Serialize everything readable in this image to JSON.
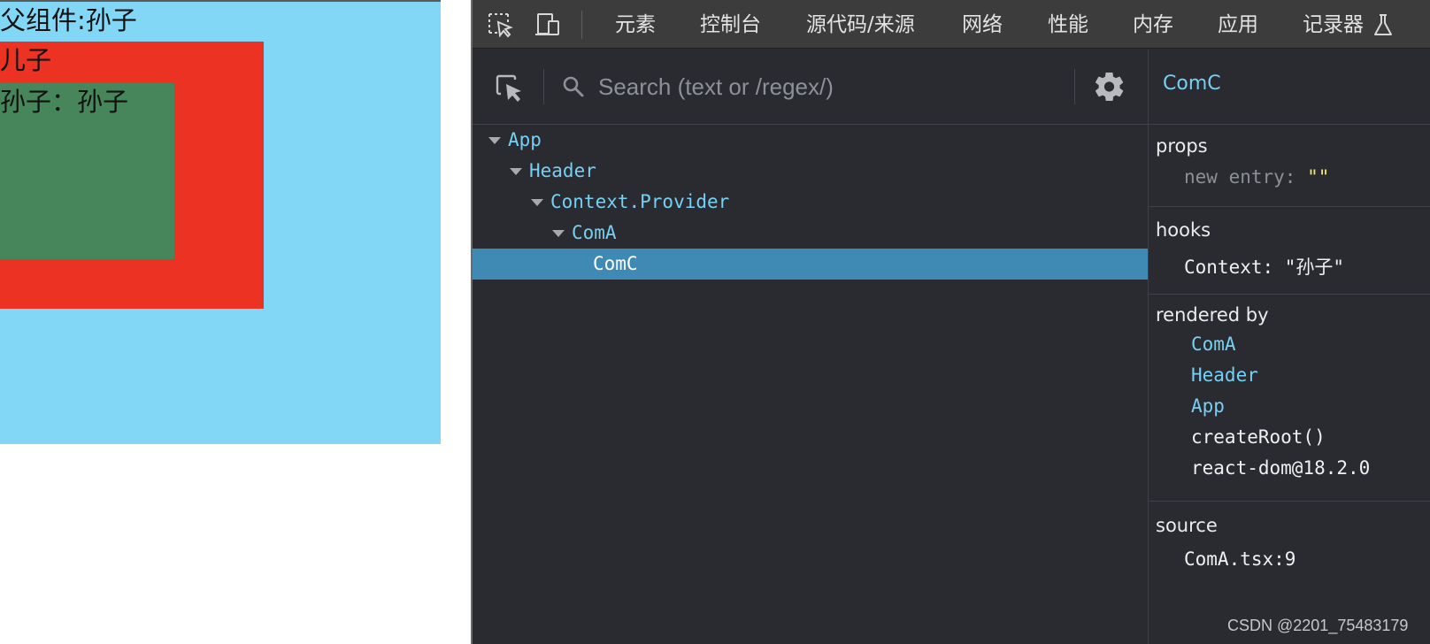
{
  "page": {
    "parent_label": "父组件:孙子",
    "son_label": "儿子",
    "grandson_label": "孙子：孙子",
    "colors": {
      "parent_bg": "#82d7f6",
      "son_bg": "#ec3323",
      "grandson_bg": "#47855a"
    }
  },
  "devtools": {
    "toolbar": {
      "icons": [
        "element-picker-icon",
        "device-toggle-icon"
      ],
      "tabs": [
        "元素",
        "控制台",
        "源代码/来源",
        "网络",
        "性能",
        "内存",
        "应用",
        "记录器"
      ],
      "recorder_icon": "flask-icon"
    },
    "search": {
      "placeholder": "Search (text or /regex/)",
      "value": ""
    },
    "tree": [
      {
        "label": "App",
        "expanded": true,
        "selected": false
      },
      {
        "label": "Header",
        "expanded": true,
        "selected": false
      },
      {
        "label": "Context.Provider",
        "expanded": true,
        "selected": false
      },
      {
        "label": "ComA",
        "expanded": true,
        "selected": false
      },
      {
        "label": "ComC",
        "expanded": false,
        "selected": true
      }
    ],
    "side": {
      "title": "ComC",
      "props": {
        "title": "props",
        "key": "new entry",
        "sep": ":",
        "value": "\"\""
      },
      "hooks": {
        "title": "hooks",
        "entry": "Context: \"孙子\""
      },
      "rendered_by": {
        "title": "rendered by",
        "items": [
          "ComA",
          "Header",
          "App",
          "createRoot()",
          "react-dom@18.2.0"
        ]
      },
      "source": {
        "title": "source",
        "value": "ComA.tsx:9"
      }
    },
    "colors": {
      "bg": "#292b31",
      "toolbar_bg": "#3c3c3c",
      "component_blue": "#76d0f3",
      "selected_row": "#3f89b5",
      "string_yellow": "#f5ea6a"
    }
  },
  "watermark": "CSDN @2201_75483179"
}
